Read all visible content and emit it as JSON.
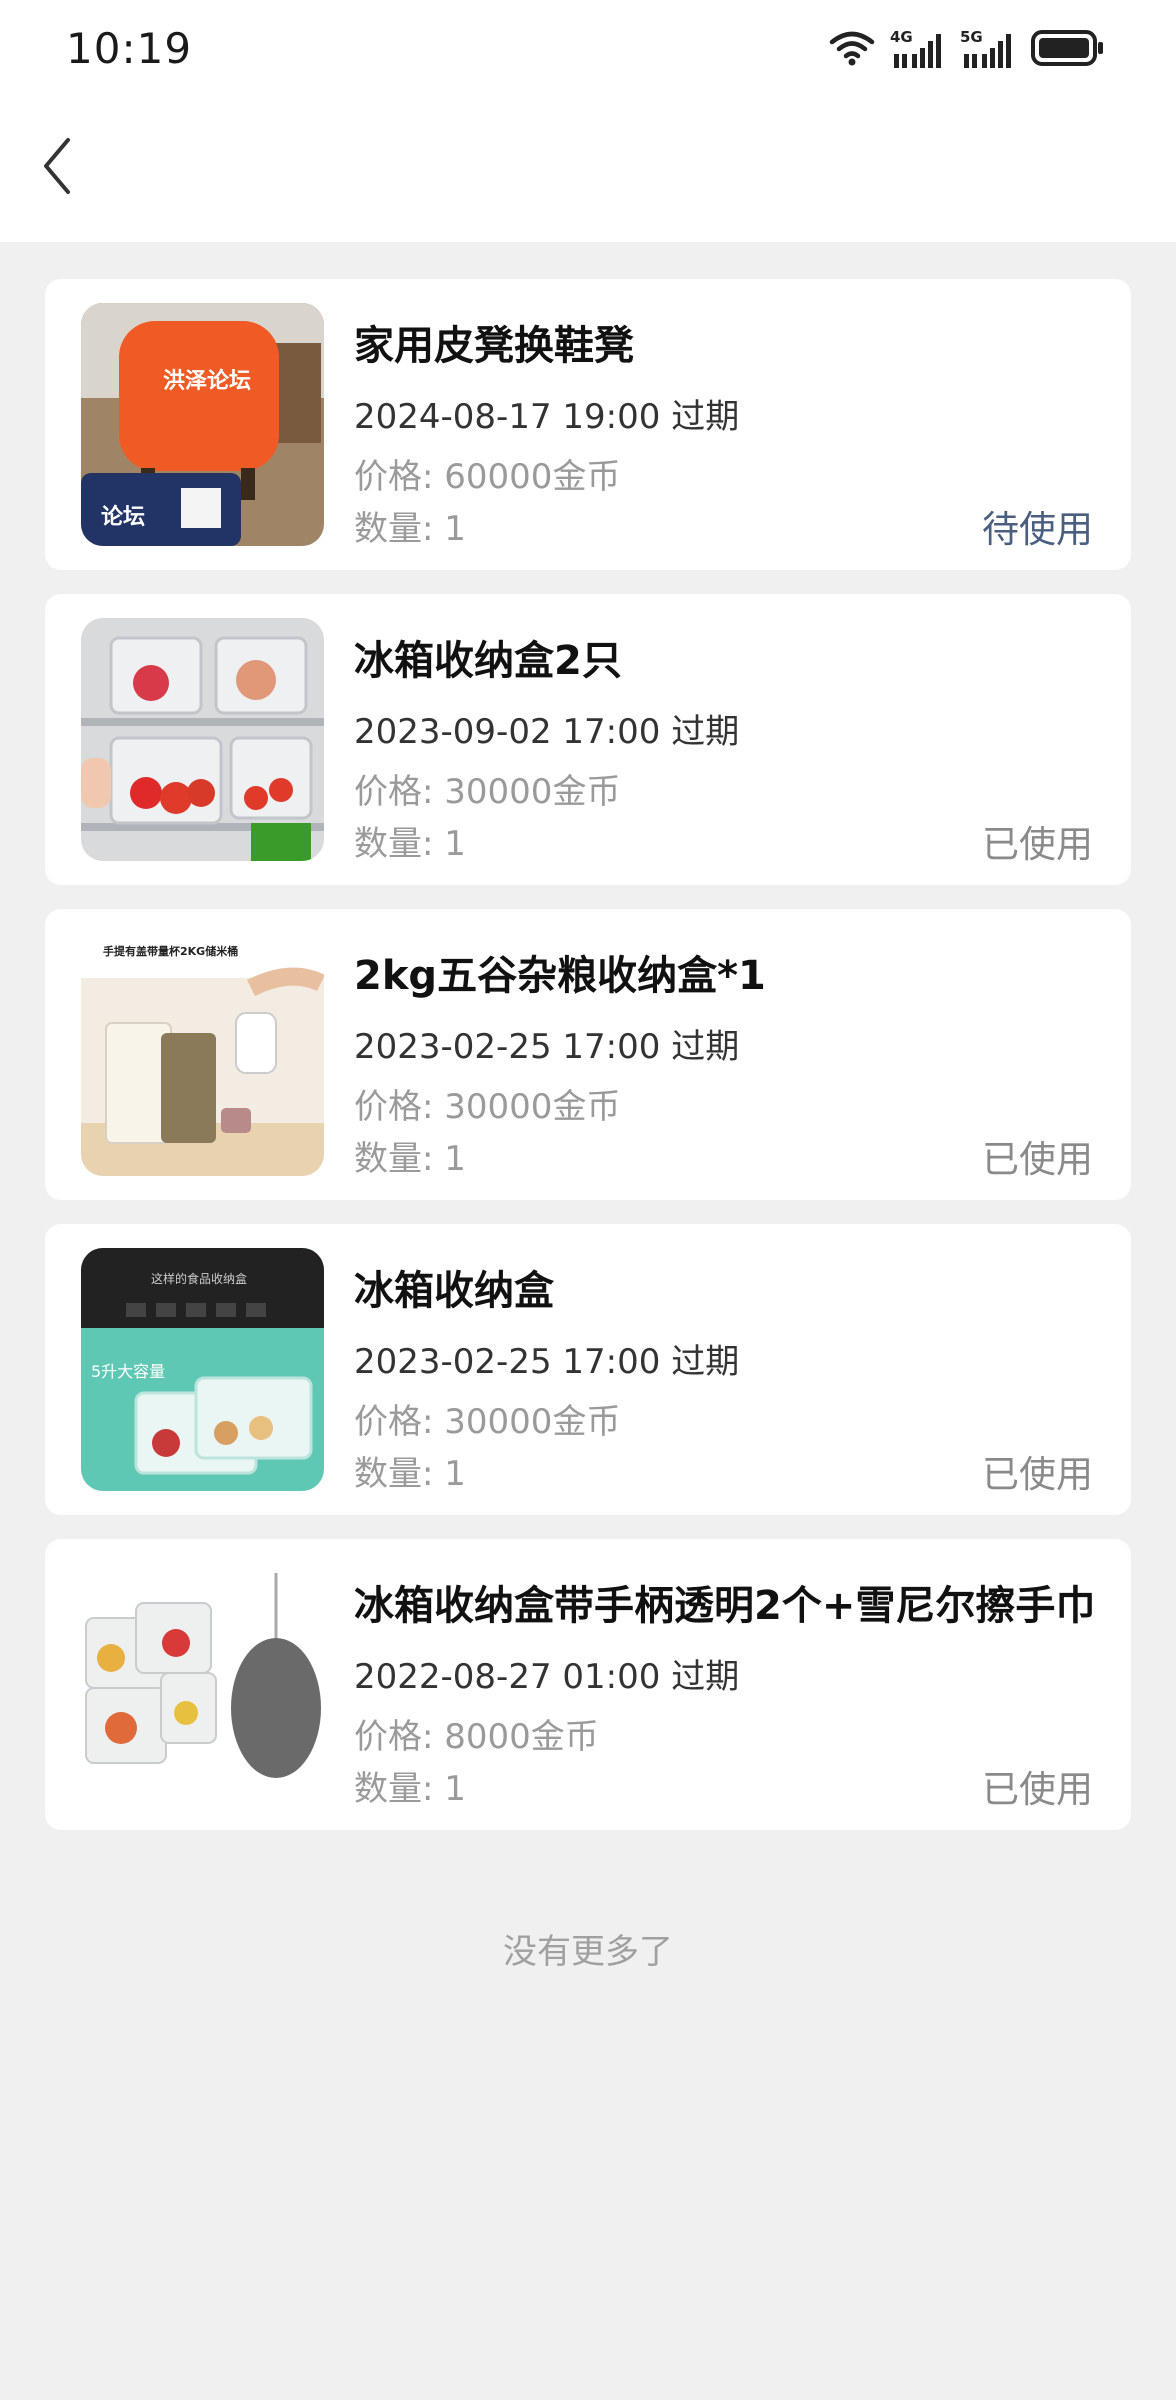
{
  "status_bar": {
    "time": "10:19",
    "network_1": "4G",
    "network_2": "5G",
    "icons": [
      "wifi-icon",
      "signal-4g-icon",
      "signal-5g-icon",
      "battery-icon"
    ]
  },
  "nav": {
    "back_icon": "chevron-left-icon"
  },
  "items": [
    {
      "title": "家用皮凳换鞋凳",
      "expiry": "2024-08-17 19:00 过期",
      "price_label": "价格:",
      "price": "60000金币",
      "qty_label": "数量:",
      "qty": "1",
      "status": "待使用",
      "image_text_1": "洪泽论坛",
      "image_text_2": "论坛"
    },
    {
      "title": "冰箱收纳盒2只",
      "expiry": "2023-09-02 17:00 过期",
      "price_label": "价格:",
      "price": "30000金币",
      "qty_label": "数量:",
      "qty": "1",
      "status": "已使用"
    },
    {
      "title": "2kg五谷杂粮收纳盒*1",
      "expiry": "2023-02-25 17:00 过期",
      "price_label": "价格:",
      "price": "30000金币",
      "qty_label": "数量:",
      "qty": "1",
      "status": "已使用",
      "image_text_1": "手提有盖带量杯2KG储米桶"
    },
    {
      "title": "冰箱收纳盒",
      "expiry": "2023-02-25 17:00 过期",
      "price_label": "价格:",
      "price": "30000金币",
      "qty_label": "数量:",
      "qty": "1",
      "status": "已使用",
      "image_text_1": "这样的食品收纳盒",
      "image_text_2": "5升大容量"
    },
    {
      "title": "冰箱收纳盒带手柄透明2个+雪尼尔擦手巾",
      "expiry": "2022-08-27 01:00 过期",
      "price_label": "价格:",
      "price": "8000金币",
      "qty_label": "数量:",
      "qty": "1",
      "status": "已使用"
    }
  ],
  "footer": {
    "no_more": "没有更多了"
  },
  "colors": {
    "background": "#f0f0f0",
    "card": "#ffffff",
    "status_pending": "#4a5f80",
    "status_used": "#8a8a8a"
  }
}
